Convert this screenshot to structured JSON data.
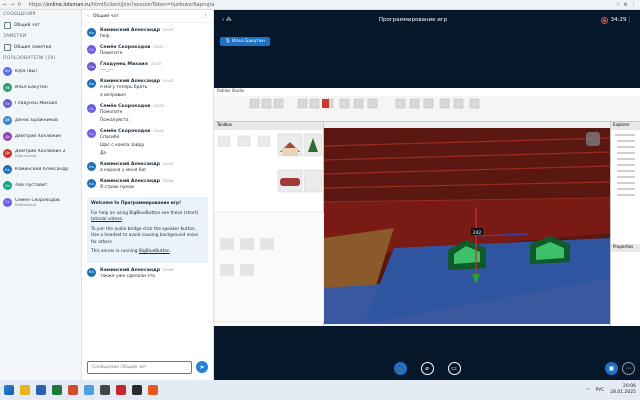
{
  "browser": {
    "url_prefix": "https://",
    "url_host": "online.lotsman.ru",
    "url_rest": "/html5client/join?sessionToken=fuzdowxr6aprujta"
  },
  "users_panel": {
    "messages_title": "СООБЩЕНИЯ",
    "public_chat": "Общий чат",
    "notes_title": "ЗАМЕТКИ",
    "shared_notes": "Общие заметки",
    "users_title": "ПОЛЬЗОВАТЕЛИ (19)",
    "users": [
      {
        "initials": "Юз",
        "name": "Юра (Вы)",
        "sub": "",
        "color": "#5b6ee1"
      },
      {
        "initials": "Иб",
        "name": "Илья Бакутин",
        "sub": "",
        "color": "#2e9a6b"
      },
      {
        "initials": "Гм",
        "name": "Гладунец Михаил",
        "sub": "",
        "color": "#6a5acd"
      },
      {
        "initials": "Дб",
        "name": "Денис Бражников",
        "sub": "",
        "color": "#3b86c9"
      },
      {
        "initials": "Дх",
        "name": "Дмитрий Хохлюкин",
        "sub": "",
        "color": "#8e44ad"
      },
      {
        "initials": "Дх",
        "name": "Дмитрий Хохлюкин 2",
        "sub": "Мобильный",
        "color": "#c0392b"
      },
      {
        "initials": "Ка",
        "name": "Каминский Александр",
        "sub": "",
        "color": "#1e6fb5"
      },
      {
        "initials": "Лп",
        "name": "Лев Пустовит",
        "sub": "",
        "color": "#16a085"
      },
      {
        "initials": "Сс",
        "name": "Семён Скорокодов",
        "sub": "Мобильный",
        "color": "#6c5ce7"
      }
    ]
  },
  "chat": {
    "title": "Общий чат",
    "messages": [
      {
        "initials": "Ка",
        "color": "#1e6fb5",
        "name": "Каминский Александр",
        "time": "20:02",
        "lines": [
          "help"
        ]
      },
      {
        "initials": "Сс",
        "color": "#6c5ce7",
        "name": "Семён Скорокодов",
        "time": "20:02",
        "lines": [
          "Помогите"
        ]
      },
      {
        "initials": "Гм",
        "color": "#6a5acd",
        "name": "Гладунец Михаил",
        "time": "20:02",
        "lines": [
          "----_---"
        ]
      },
      {
        "initials": "Ка",
        "color": "#1e6fb5",
        "name": "Каминский Александр",
        "time": "20:02",
        "lines": [
          "я могу теперь брать",
          "я исправил"
        ]
      },
      {
        "initials": "Сс",
        "color": "#6c5ce7",
        "name": "Семён Скорокодов",
        "time": "20:03",
        "lines": [
          "Помогите",
          "Пожалуйста"
        ]
      },
      {
        "initials": "Сс",
        "color": "#6c5ce7",
        "name": "Семён Скорокодов",
        "time": "20:04",
        "lines": [
          "Спасибо",
          "Щас с компа зайду",
          "Да"
        ]
      },
      {
        "initials": "Ка",
        "color": "#1e6fb5",
        "name": "Каминский Александр",
        "time": "20:05",
        "lines": [
          "а корона у меня баг"
        ]
      },
      {
        "initials": "Ка",
        "color": "#1e6fb5",
        "name": "Каминский Александр",
        "time": "20:06",
        "lines": [
          "Я строю пуком"
        ]
      }
    ],
    "welcome": {
      "heading_prefix": "Welcome to ",
      "heading_name": "Программирование игр!",
      "help_prefix": "For help on using BigBlueButton see these (short) ",
      "help_link": "tutorial videos",
      "audio": "To join the audio bridge click the speaker button. Use a headset to avoid causing background noise for others.",
      "server_prefix": "This server is running ",
      "server_link": "BigBlueButton"
    },
    "last_message": {
      "initials": "Ка",
      "color": "#1e6fb5",
      "name": "Каминский Александр",
      "time": "20:06",
      "lines": [
        "также уже сделали это"
      ]
    },
    "input_placeholder": "Сообщение Общий чат"
  },
  "stage": {
    "title": "Программирование игр",
    "timer": "34:29",
    "talker": "Илья Бакутин",
    "studio_title": "Roblox Studio",
    "toolbox_title": "Toolbox",
    "explorer_title": "Explorer",
    "properties_title": "Properties",
    "tag_value": "242"
  },
  "taskbar": {
    "lang": "РУС",
    "time": "20:06",
    "date": "28.01.2025"
  },
  "colors": {
    "brand": "#1a73c8",
    "stage_bg": "#06172a",
    "wall_red": "#7a1a14",
    "floor_blue": "#2f55a0"
  }
}
